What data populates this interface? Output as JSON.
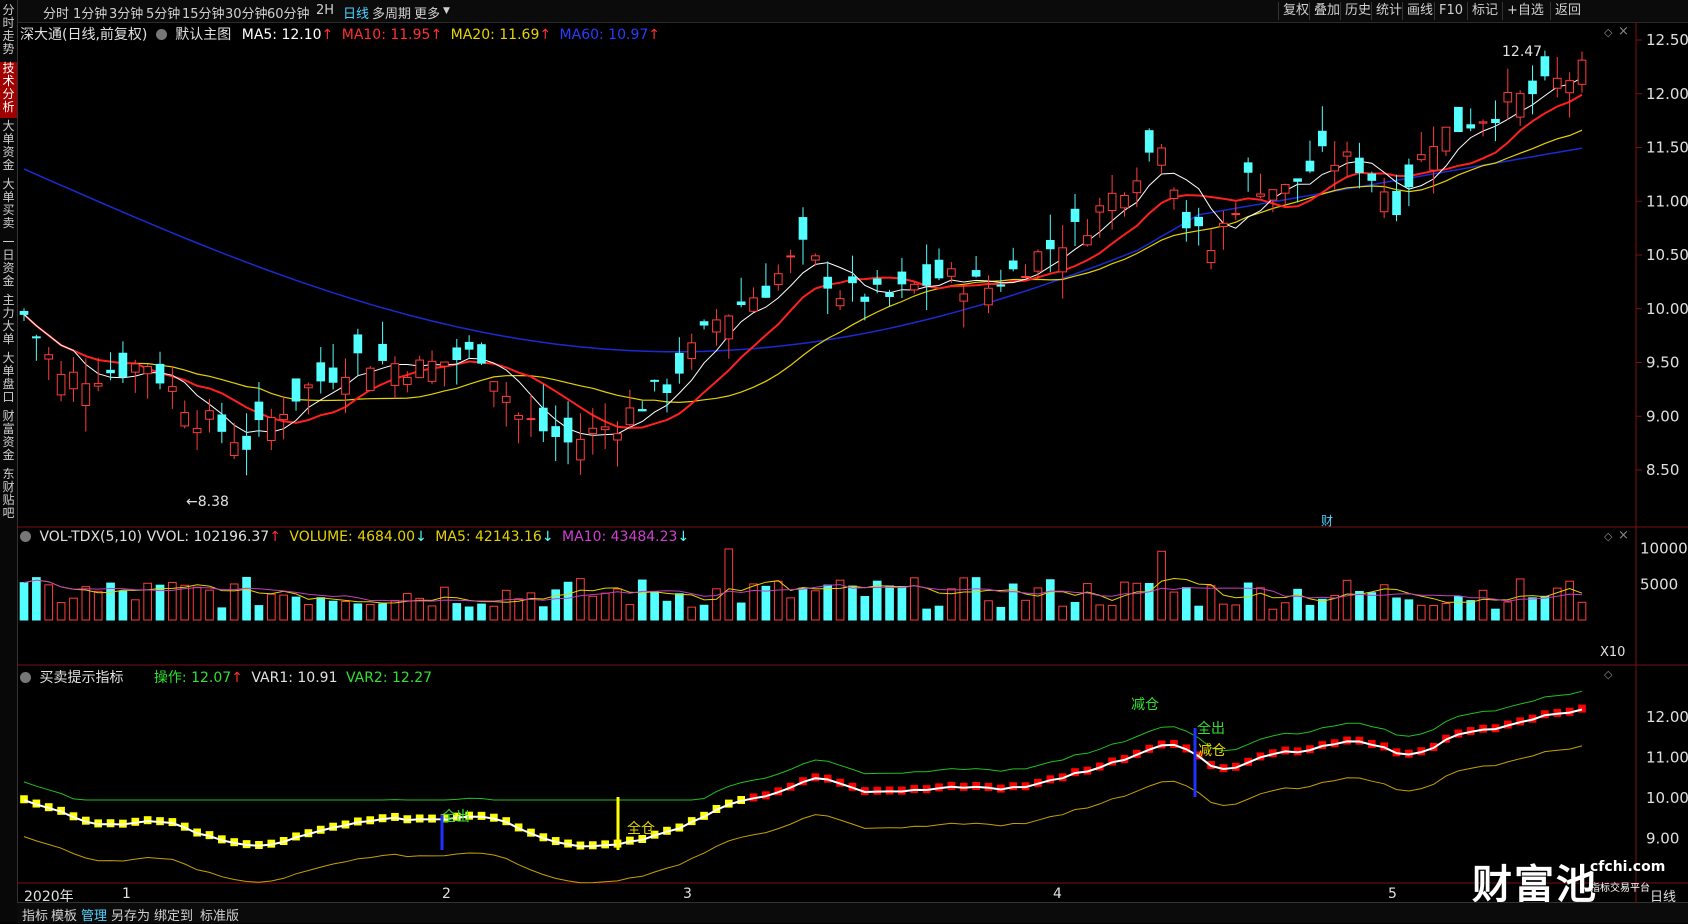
{
  "toolbar": {
    "periods": [
      "分时",
      "1分钟",
      "3分钟",
      "5分钟",
      "15分钟",
      "30分钟",
      "60分钟",
      "2H",
      "日线",
      "多周期",
      "更多"
    ],
    "active_period": "日线",
    "right_buttons": [
      "复权",
      "叠加",
      "历史",
      "统计",
      "画线",
      "F10",
      "标记",
      "+自选",
      "返回"
    ]
  },
  "sidebar": {
    "items": [
      "分时走势",
      "技术分析",
      "大单资金",
      "大单买卖",
      "一日资金",
      "主力大单",
      "大单盘口",
      "财富资金",
      "东财贴吧"
    ],
    "active": "技术分析"
  },
  "main_chart": {
    "title": "深大通(日线,前复权)",
    "template": "默认主图",
    "ma5": "MA5: 12.10",
    "ma10": "MA10: 11.95",
    "ma20": "MA20: 11.69",
    "ma60": "MA60: 10.97",
    "high_label": "12.47",
    "low_label": "8.38",
    "cai_label": "财",
    "y_ticks": [
      "12.50",
      "12.00",
      "11.50",
      "11.00",
      "10.50",
      "10.00",
      "9.50",
      "9.00",
      "8.50"
    ]
  },
  "volume_chart": {
    "title": "VOL-TDX(5,10)",
    "vvol": "VVOL: 102196.37",
    "volume": "VOLUME: 4684.00",
    "ma5": "MA5: 42143.16",
    "ma10": "MA10: 43484.23",
    "y_ticks": [
      "10000",
      "5000"
    ],
    "unit": "X10"
  },
  "signal_chart": {
    "title": "买卖提示指标",
    "op": "操作: 12.07",
    "var1": "VAR1: 10.91",
    "var2": "VAR2: 12.27",
    "y_ticks": [
      "12.00",
      "11.00",
      "10.00",
      "9.00"
    ],
    "labels": {
      "jiancang1": "减仓",
      "quanchu1": "全出",
      "quancang": "全仓",
      "quanchu2": "全出",
      "jiancang2": "减仓"
    }
  },
  "xaxis": {
    "year": "2020年",
    "months": [
      "1",
      "2",
      "3",
      "4",
      "5"
    ],
    "period": "日线"
  },
  "watermark": {
    "brand": "财富池",
    "site": "cfchi.com",
    "tagline": "指标交易平台"
  },
  "bottombar": {
    "items": [
      "指标",
      "模板",
      "管理",
      "另存为",
      "绑定到",
      "标准版"
    ],
    "active": "管理"
  },
  "colors": {
    "up": "#ff3c3c",
    "down": "#54ffff",
    "ma5": "#ffffff",
    "ma10": "#ff2020",
    "ma20": "#e6d200",
    "ma60": "#1a2bd0"
  }
}
